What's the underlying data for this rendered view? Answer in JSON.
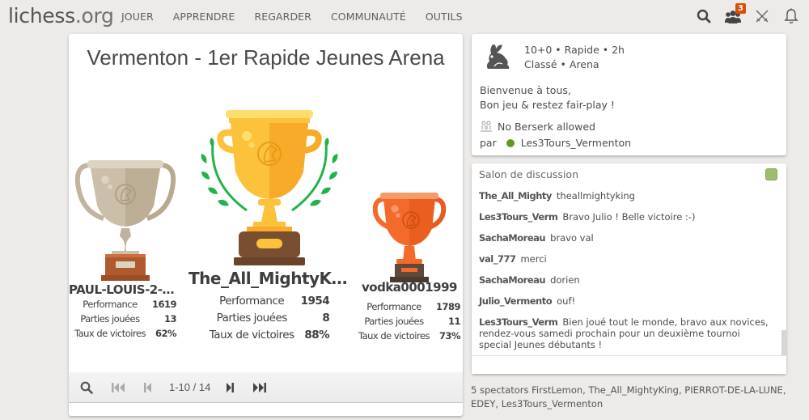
{
  "header": {
    "logo_name": "lichess",
    "logo_tld": ".org",
    "nav": [
      "JOUER",
      "APPRENDRE",
      "REGARDER",
      "COMMUNAUTÉ",
      "OUTILS"
    ],
    "friends_badge": "3",
    "icons": [
      "search-icon",
      "friends-icon",
      "challenge-swords-icon",
      "notification-bell-icon"
    ]
  },
  "tournament": {
    "title": "Vermenton - 1er Rapide Jeunes Arena",
    "podium": [
      {
        "rank": 1,
        "name": "The_All_MightyKing",
        "trophy": "gold",
        "stats": [
          {
            "label": "Performance",
            "value": "1954"
          },
          {
            "label": "Parties jouées",
            "value": "8"
          },
          {
            "label": "Taux de victoires",
            "value": "88%"
          }
        ]
      },
      {
        "rank": 2,
        "name": "PAUL-LOUIS-2-R…",
        "trophy": "silver",
        "stats": [
          {
            "label": "Performance",
            "value": "1619"
          },
          {
            "label": "Parties jouées",
            "value": "13"
          },
          {
            "label": "Taux de victoires",
            "value": "62%"
          }
        ]
      },
      {
        "rank": 3,
        "name": "vodka0001999",
        "trophy": "bronze",
        "stats": [
          {
            "label": "Performance",
            "value": "1789"
          },
          {
            "label": "Parties jouées",
            "value": "11"
          },
          {
            "label": "Taux de victoires",
            "value": "73%"
          }
        ]
      }
    ],
    "pager": {
      "range": "1-10 / 14"
    }
  },
  "info": {
    "setup_line1": "10+0 • Rapide • 2h",
    "setup_line2": "Classé • Arena",
    "desc_line1": "Bienvenue à tous,",
    "desc_line2": "Bon jeu & restez fair-play !",
    "berserk": "No Berserk allowed",
    "by_label": "par",
    "creator": "Les3Tours_Vermenton",
    "creator_status_color": "#629924"
  },
  "chat": {
    "title": "Salon de discussion",
    "messages": [
      {
        "user": "The_All_Mighty",
        "text": "theallmightyking"
      },
      {
        "user": "Les3Tours_Verm",
        "text": "Bravo Julio ! Belle victoire :-)"
      },
      {
        "user": "SachaMoreau",
        "text": "bravo val"
      },
      {
        "user": "val_777",
        "text": "merci"
      },
      {
        "user": "SachaMoreau",
        "text": "dorien"
      },
      {
        "user": "Julio_Vermento",
        "text": "ouf!"
      },
      {
        "user": "Les3Tours_Verm",
        "text": "Bien joué tout le monde, bravo aux novices, rendez-vous samedi prochain pour un deuxième tournoi special Jeunes débutants !"
      }
    ]
  },
  "spectators": "5 spectators FirstLemon, The_All_MightyKing, PIERROT-DE-LA-LUNE, EDEY, Les3Tours_Vermenton"
}
